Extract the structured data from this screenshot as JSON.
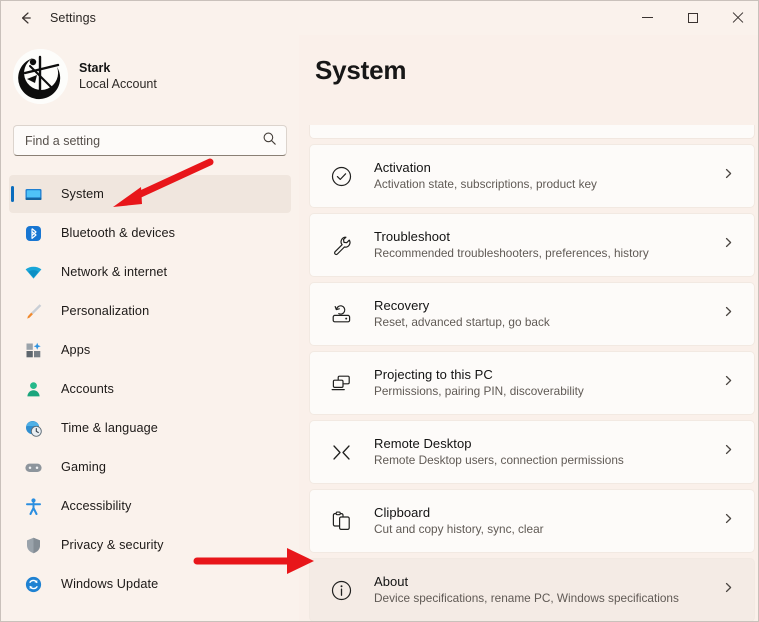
{
  "window": {
    "title": "Settings",
    "back_icon": "back-arrow-icon",
    "controls": {
      "minimize": "minimize-icon",
      "maximize": "maximize-icon",
      "close": "close-icon"
    }
  },
  "sidebar": {
    "profile": {
      "name": "Stark",
      "account_type": "Local Account",
      "avatar": "user-avatar"
    },
    "search": {
      "placeholder": "Find a setting",
      "value": "",
      "icon": "search-icon"
    },
    "items": [
      {
        "label": "System",
        "icon": "monitor-icon",
        "selected": true
      },
      {
        "label": "Bluetooth & devices",
        "icon": "bluetooth-icon",
        "selected": false
      },
      {
        "label": "Network & internet",
        "icon": "wifi-icon",
        "selected": false
      },
      {
        "label": "Personalization",
        "icon": "paintbrush-icon",
        "selected": false
      },
      {
        "label": "Apps",
        "icon": "apps-grid-icon",
        "selected": false
      },
      {
        "label": "Accounts",
        "icon": "person-icon",
        "selected": false
      },
      {
        "label": "Time & language",
        "icon": "clock-globe-icon",
        "selected": false
      },
      {
        "label": "Gaming",
        "icon": "gamepad-icon",
        "selected": false
      },
      {
        "label": "Accessibility",
        "icon": "accessibility-person-icon",
        "selected": false
      },
      {
        "label": "Privacy & security",
        "icon": "shield-icon",
        "selected": false
      },
      {
        "label": "Windows Update",
        "icon": "update-refresh-icon",
        "selected": false
      }
    ]
  },
  "main": {
    "title": "System",
    "cards": [
      {
        "title": "Activation",
        "subtitle": "Activation state, subscriptions, product key",
        "icon": "check-circle-icon",
        "chevron": "chevron-right-icon",
        "hovered": false
      },
      {
        "title": "Troubleshoot",
        "subtitle": "Recommended troubleshooters, preferences, history",
        "icon": "wrench-icon",
        "chevron": "chevron-right-icon",
        "hovered": false
      },
      {
        "title": "Recovery",
        "subtitle": "Reset, advanced startup, go back",
        "icon": "recovery-icon",
        "chevron": "chevron-right-icon",
        "hovered": false
      },
      {
        "title": "Projecting to this PC",
        "subtitle": "Permissions, pairing PIN, discoverability",
        "icon": "projecting-screens-icon",
        "chevron": "chevron-right-icon",
        "hovered": false
      },
      {
        "title": "Remote Desktop",
        "subtitle": "Remote Desktop users, connection permissions",
        "icon": "remote-desktop-icon",
        "chevron": "chevron-right-icon",
        "hovered": false
      },
      {
        "title": "Clipboard",
        "subtitle": "Cut and copy history, sync, clear",
        "icon": "clipboard-icon",
        "chevron": "chevron-right-icon",
        "hovered": false
      },
      {
        "title": "About",
        "subtitle": "Device specifications, rename PC, Windows specifications",
        "icon": "info-circle-icon",
        "chevron": "chevron-right-icon",
        "hovered": true
      }
    ]
  },
  "annotations": {
    "color": "#e8161a",
    "arrows": [
      {
        "name": "arrow-pointing-to-system",
        "target": "System"
      },
      {
        "name": "arrow-pointing-to-about",
        "target": "About"
      }
    ]
  },
  "colors": {
    "accent": "#0a6cbd",
    "window_background": "#faf2ec",
    "content_background": "#faf0ea",
    "card_background": "#fdfbf9",
    "annotation_red": "#e8161a"
  }
}
